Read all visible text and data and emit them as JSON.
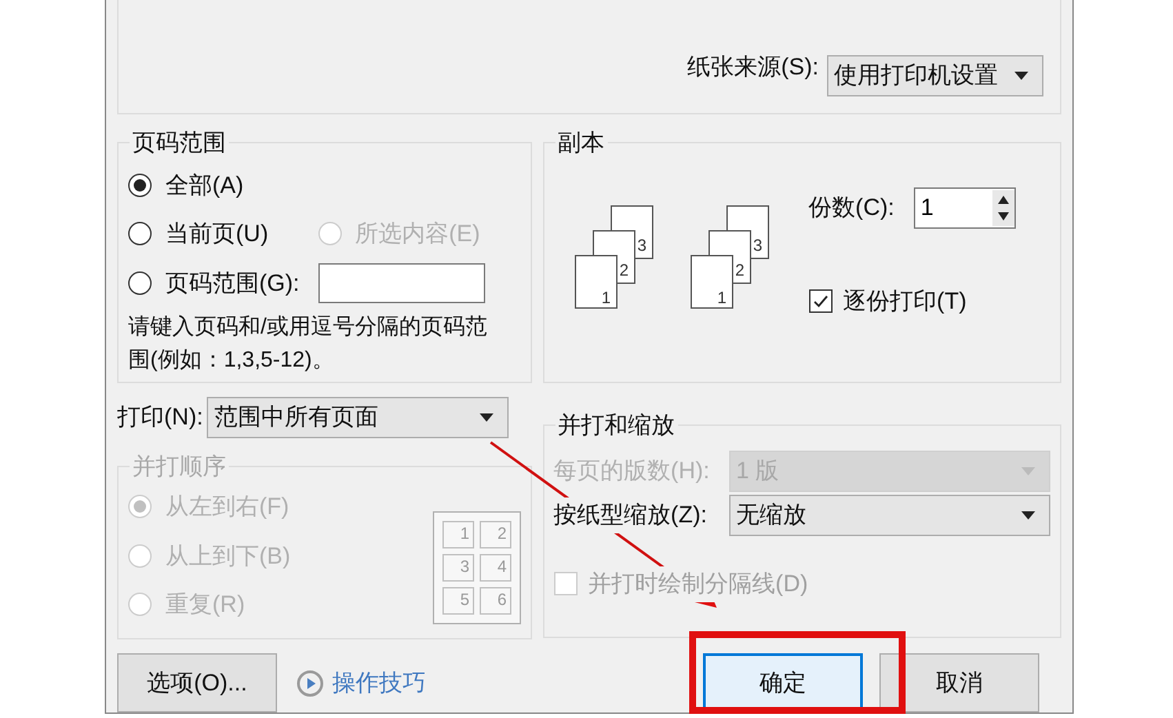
{
  "paper_source": {
    "label": "纸张来源(S):",
    "value": "使用打印机设置"
  },
  "page_range": {
    "title": "页码范围",
    "options": [
      {
        "kind": "plain",
        "label": "全部(A)",
        "selected": true,
        "disabled": false
      },
      {
        "kind": "plain",
        "label": "当前页(U)",
        "selected": false,
        "disabled": false
      },
      {
        "kind": "plain",
        "label": "所选内容(E)",
        "selected": false,
        "disabled": true
      },
      {
        "kind": "field",
        "label": "页码范围(G):",
        "selected": false,
        "disabled": false
      }
    ],
    "hint": "请键入页码和/或用逗号分隔的页码范围(例如：1,3,5-12)。"
  },
  "copies": {
    "title": "副本",
    "count_label": "份数(C):",
    "count_value": "1",
    "collate": {
      "label": "逐份打印(T)",
      "checked": true
    },
    "stacks": [
      [
        "1",
        "2",
        "3"
      ],
      [
        "1",
        "2",
        "3"
      ]
    ]
  },
  "print": {
    "label": "打印(N):",
    "value": "范围中所有页面"
  },
  "collate_order": {
    "title": "并打顺序",
    "disabled": true,
    "options": [
      {
        "label": "从左到右(F)",
        "selected": true
      },
      {
        "label": "从上到下(B)",
        "selected": false
      },
      {
        "label": "重复(R)",
        "selected": false
      }
    ],
    "grid_numbers": [
      "1",
      "2",
      "3",
      "4",
      "5",
      "6"
    ]
  },
  "zoom": {
    "title": "并打和缩放",
    "pages_per_sheet": {
      "label": "每页的版数(H):",
      "value": "1 版",
      "disabled": true
    },
    "scale": {
      "label": "按纸型缩放(Z):",
      "value": "无缩放",
      "disabled": false
    },
    "draw_borders": {
      "label": "并打时绘制分隔线(D)",
      "checked": false,
      "disabled": true
    }
  },
  "buttons": {
    "options": "选项(O)...",
    "tips": "操作技巧",
    "ok": "确定",
    "cancel": "取消"
  }
}
